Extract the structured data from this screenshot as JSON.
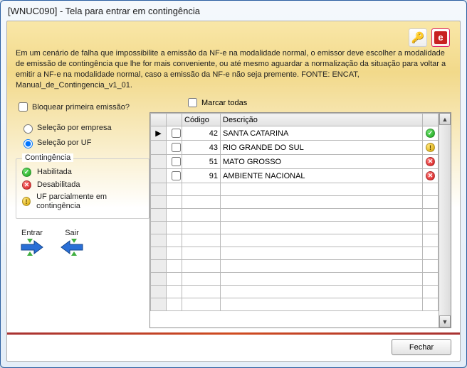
{
  "window": {
    "title": "[WNUC090] - Tela para entrar em contingência"
  },
  "intro": "Em um cenário de falha que impossibilite a emissão da NF-e na modalidade normal, o emissor deve escolher a modalidade de emissão de contingência que lhe for mais conveniente, ou até mesmo aguardar a normalização da situação para voltar a emitir a NF-e na modalidade normal, caso a emissão da NF-e não seja premente. FONTE: ENCAT, Manual_de_Contingencia_v1_01.",
  "left": {
    "bloquear_label": "Bloquear primeira emissão?",
    "radio_empresa": "Seleção por empresa",
    "radio_uf": "Seleção por UF"
  },
  "legend": {
    "title": "Contingência",
    "habilitada": "Habilitada",
    "desabilitada": "Desabilitada",
    "parcial": "UF parcialmente em contingência"
  },
  "actions": {
    "entrar": "Entrar",
    "sair": "Sair"
  },
  "grid": {
    "marcar_todas": "Marcar todas",
    "headers": {
      "codigo": "Código",
      "descricao": "Descrição"
    },
    "rows": [
      {
        "selected": true,
        "checked": false,
        "codigo": "42",
        "descricao": "SANTA CATARINA",
        "status": "green"
      },
      {
        "selected": false,
        "checked": false,
        "codigo": "43",
        "descricao": "RIO GRANDE DO SUL",
        "status": "yellow"
      },
      {
        "selected": false,
        "checked": false,
        "codigo": "51",
        "descricao": "MATO GROSSO",
        "status": "red"
      },
      {
        "selected": false,
        "checked": false,
        "codigo": "91",
        "descricao": "AMBIENTE NACIONAL",
        "status": "red"
      }
    ],
    "blank_rows": 10
  },
  "footer": {
    "fechar": "Fechar"
  },
  "icons": {
    "key": "🔑",
    "logo_letter": "e"
  }
}
